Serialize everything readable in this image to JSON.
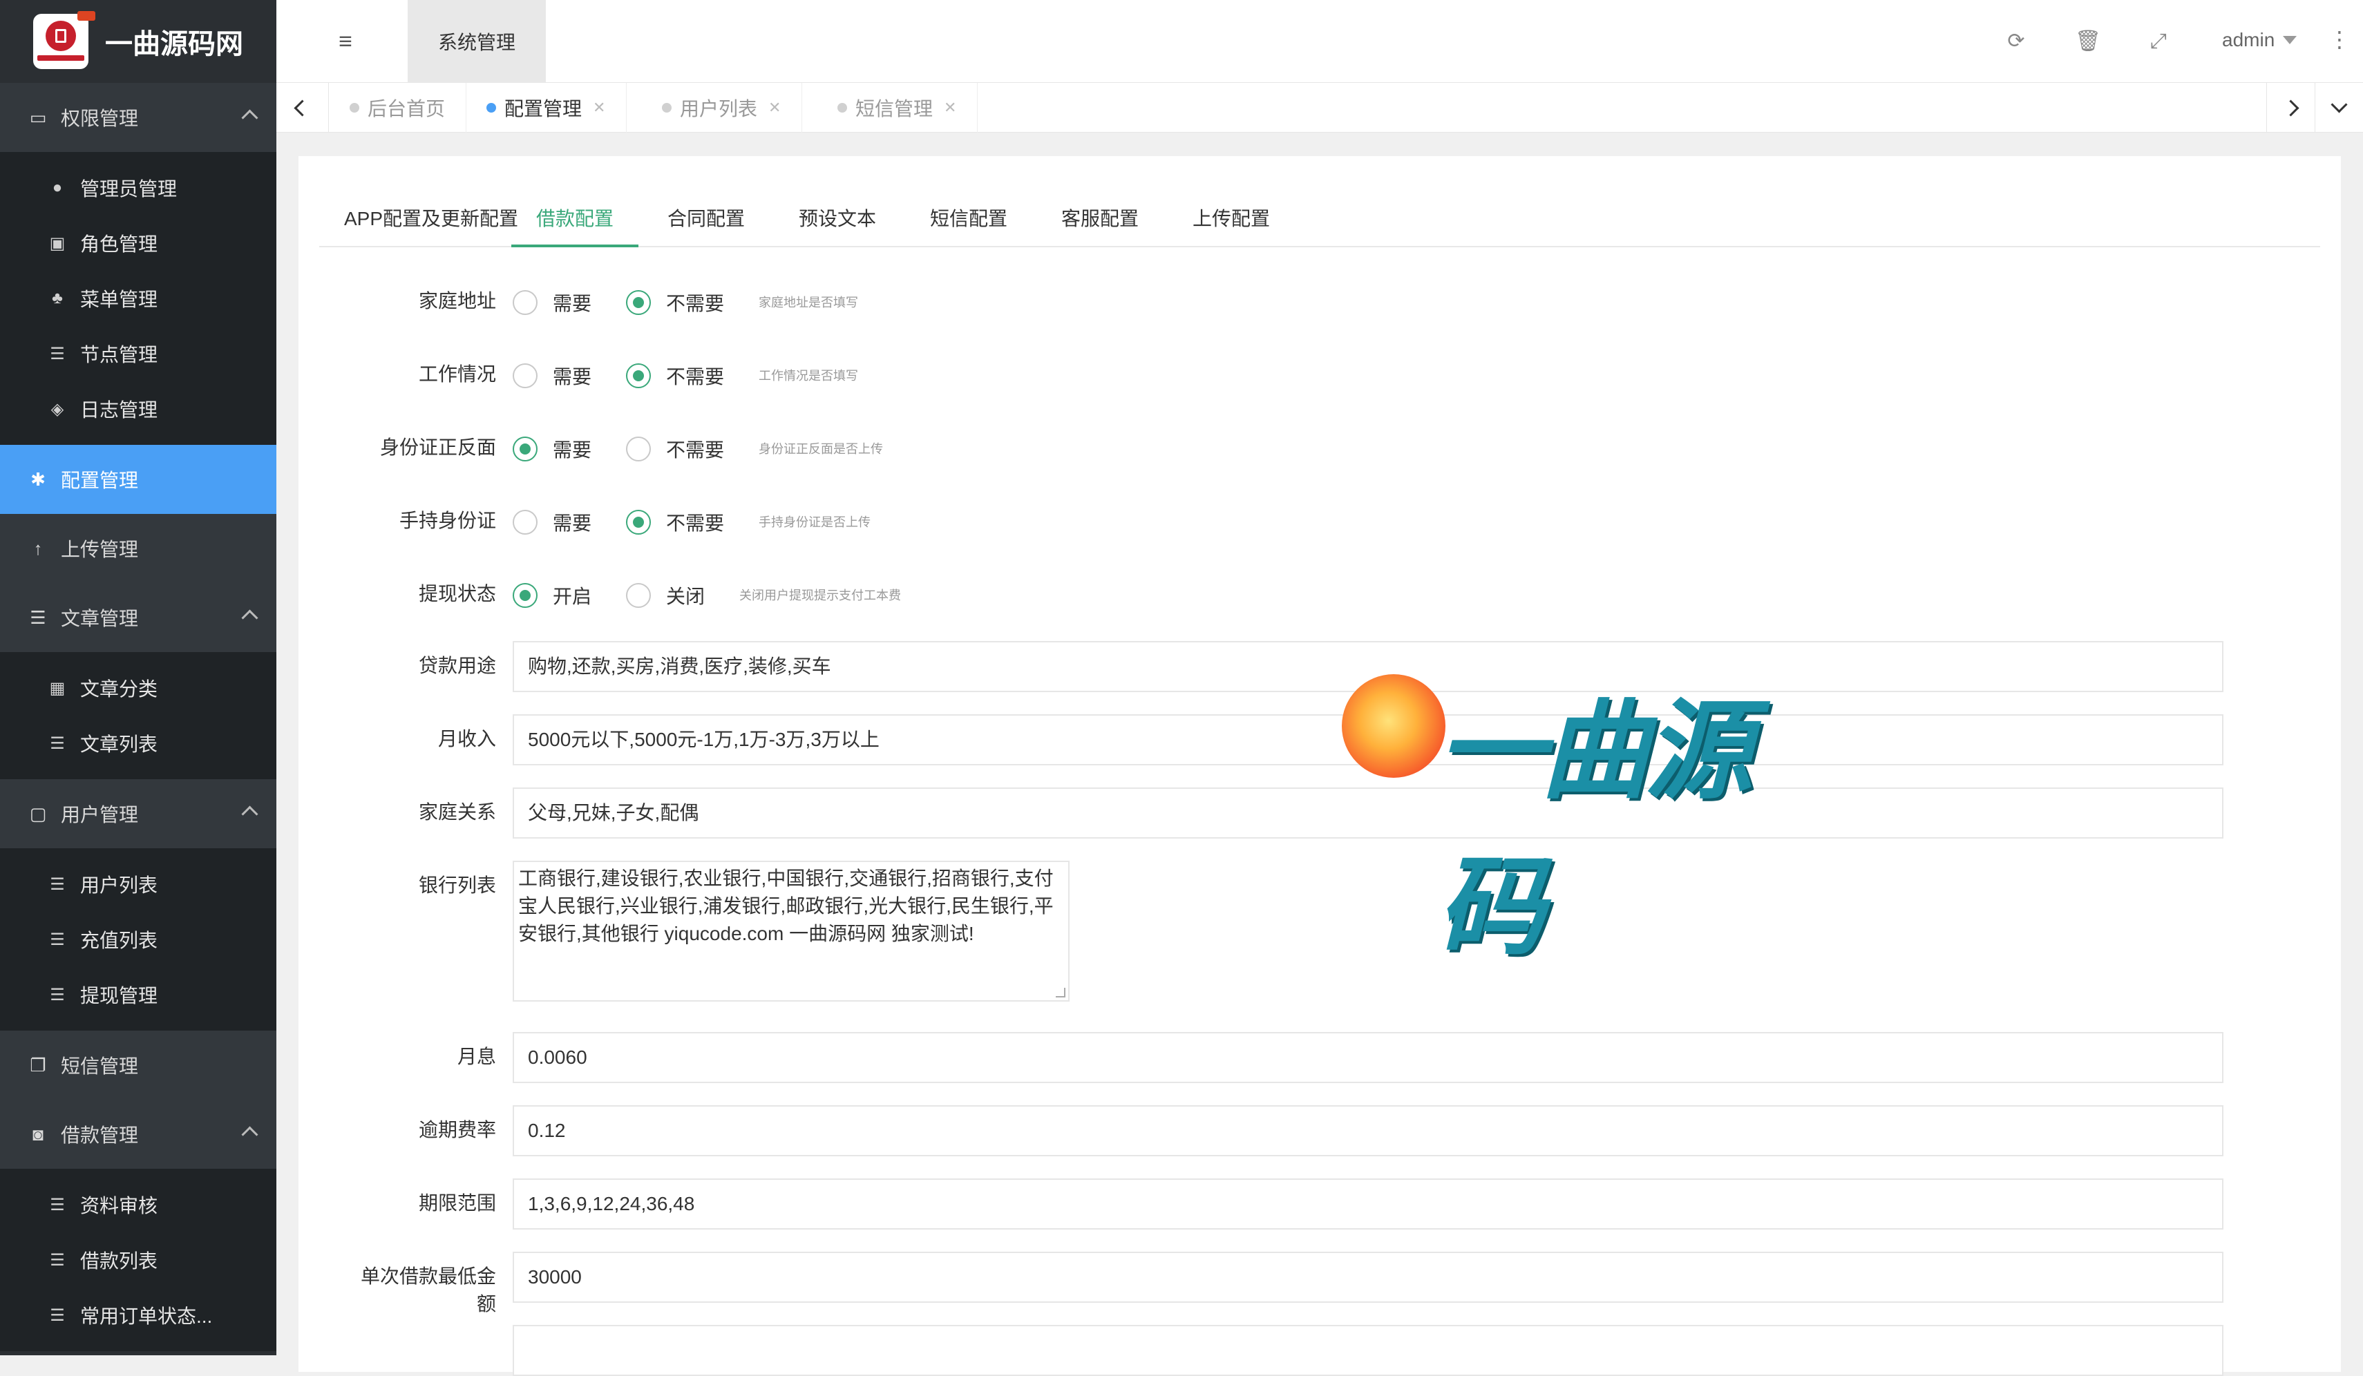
{
  "brand": {
    "name": "一曲源码网",
    "logo_text": "招商银行"
  },
  "sidebar": {
    "groups": [
      {
        "label": "权限管理",
        "icon": "monitor-icon",
        "items": [
          "管理员管理",
          "角色管理",
          "菜单管理",
          "节点管理",
          "日志管理"
        ]
      },
      {
        "label": "配置管理",
        "icon": "gear-icon",
        "active": true
      },
      {
        "label": "上传管理",
        "icon": "upload-arrow-icon"
      },
      {
        "label": "文章管理",
        "icon": "list-icon",
        "items": [
          "文章分类",
          "文章列表"
        ]
      },
      {
        "label": "用户管理",
        "icon": "user-card-icon",
        "items": [
          "用户列表",
          "充值列表",
          "提现管理"
        ]
      },
      {
        "label": "短信管理",
        "icon": "copy-icon"
      },
      {
        "label": "借款管理",
        "icon": "money-icon",
        "items": [
          "资料审核",
          "借款列表",
          "常用订单状态..."
        ]
      }
    ]
  },
  "header": {
    "section_tab": "系统管理",
    "user": "admin"
  },
  "page_tabs": [
    {
      "label": "后台首页",
      "active": false,
      "closable": false
    },
    {
      "label": "配置管理",
      "active": true,
      "closable": true
    },
    {
      "label": "用户列表",
      "active": false,
      "closable": true
    },
    {
      "label": "短信管理",
      "active": false,
      "closable": true
    }
  ],
  "config_tabs": [
    "APP配置及更新配置",
    "借款配置",
    "合同配置",
    "预设文本",
    "短信配置",
    "客服配置",
    "上传配置"
  ],
  "active_config_tab": "借款配置",
  "form": {
    "home_address": {
      "label": "家庭地址",
      "opt1": "需要",
      "opt2": "不需要",
      "selected": "不需要",
      "hint": "家庭地址是否填写"
    },
    "work_info": {
      "label": "工作情况",
      "opt1": "需要",
      "opt2": "不需要",
      "selected": "不需要",
      "hint": "工作情况是否填写"
    },
    "id_card": {
      "label": "身份证正反面",
      "opt1": "需要",
      "opt2": "不需要",
      "selected": "需要",
      "hint": "身份证正反面是否上传"
    },
    "hand_id": {
      "label": "手持身份证",
      "opt1": "需要",
      "opt2": "不需要",
      "selected": "不需要",
      "hint": "手持身份证是否上传"
    },
    "withdraw_status": {
      "label": "提现状态",
      "opt1": "开启",
      "opt2": "关闭",
      "selected": "开启",
      "hint": "关闭用户提现提示支付工本费"
    },
    "loan_purpose": {
      "label": "贷款用途",
      "value": "购物,还款,买房,消费,医疗,装修,买车"
    },
    "monthly_income": {
      "label": "月收入",
      "value": "5000元以下,5000元-1万,1万-3万,3万以上"
    },
    "family_relation": {
      "label": "家庭关系",
      "value": "父母,兄妹,子女,配偶"
    },
    "bank_list": {
      "label": "银行列表",
      "value": "工商银行,建设银行,农业银行,中国银行,交通银行,招商银行,支付宝人民银行,兴业银行,浦发银行,邮政银行,光大银行,民生银行,平安银行,其他银行 yiqucode.com  一曲源码网 独家测试!"
    },
    "monthly_interest": {
      "label": "月息",
      "value": "0.0060"
    },
    "overdue_rate": {
      "label": "逾期费率",
      "value": "0.12"
    },
    "term_range": {
      "label": "期限范围",
      "value": "1,3,6,9,12,24,36,48"
    },
    "min_loan": {
      "label": "单次借款最低金额",
      "value": "30000"
    }
  },
  "watermark": {
    "text": "一曲源码"
  },
  "colors": {
    "sidebar_bg": "#2b2f33",
    "active_blue": "#4a9ff5",
    "accent_green": "#3aa87a"
  }
}
